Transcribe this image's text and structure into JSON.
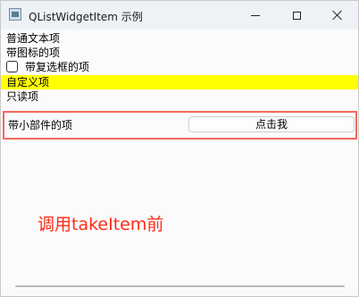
{
  "window": {
    "title": "QListWidgetItem 示例",
    "controls": {
      "minimize": "minimize",
      "maximize": "maximize",
      "close": "close"
    }
  },
  "list": {
    "items": [
      {
        "label": "普通文本项"
      },
      {
        "label": "带图标的项"
      },
      {
        "label": "带复选框的项",
        "checked": false
      },
      {
        "label": "自定义项",
        "background": "#ffff00"
      },
      {
        "label": "只读项"
      }
    ],
    "widget_item": {
      "label": "带小部件的项",
      "button_label": "点击我",
      "border_color": "#f1695d"
    }
  },
  "annotation": {
    "text": "调用takeItem前",
    "color": "#ff2b14"
  },
  "icons": {
    "app": "app-icon",
    "checkbox": "checkbox-icon"
  }
}
